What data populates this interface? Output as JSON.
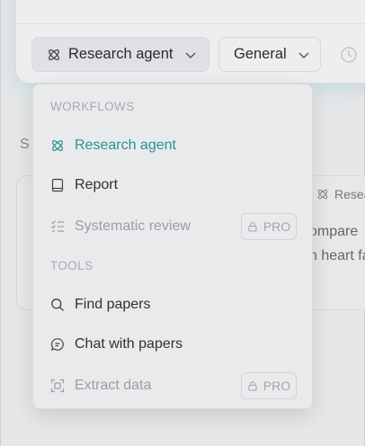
{
  "toolbar": {
    "agent_label": "Research agent",
    "mode_label": "General"
  },
  "background": {
    "section_letter": "S",
    "card_tag": "Resea",
    "card_text_line1": "ompare",
    "card_text_line2": "n heart fa"
  },
  "menu": {
    "workflows_title": "WORKFLOWS",
    "tools_title": "TOOLS",
    "items": [
      {
        "label": "Research agent",
        "icon": "atom-icon",
        "state": "active"
      },
      {
        "label": "Report",
        "icon": "document-icon",
        "state": "normal"
      },
      {
        "label": "Systematic review",
        "icon": "checklist-icon",
        "state": "locked",
        "badge": "PRO"
      },
      {
        "label": "Find papers",
        "icon": "search-icon",
        "state": "normal"
      },
      {
        "label": "Chat with papers",
        "icon": "chat-icon",
        "state": "normal"
      },
      {
        "label": "Extract data",
        "icon": "extract-icon",
        "state": "locked",
        "badge": "PRO"
      }
    ]
  },
  "colors": {
    "accent": "#2a9393",
    "muted": "#9a9ea3"
  }
}
